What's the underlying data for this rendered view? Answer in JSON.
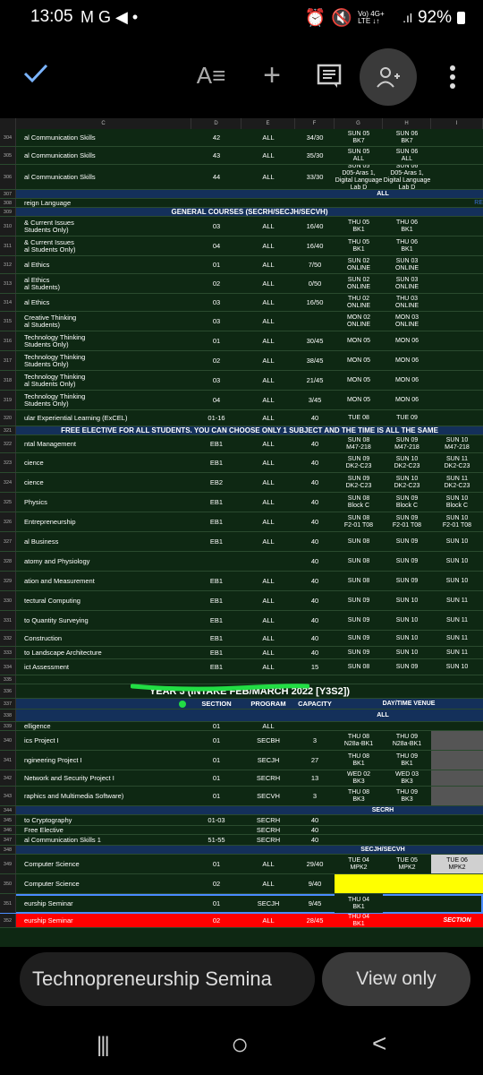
{
  "status_bar": {
    "time": "13:05",
    "notification_icons": "M G ◀ •",
    "network": "Vo) 4G+ LTE ↓↑",
    "battery": "92%"
  },
  "toolbar": {
    "icons": [
      "check-icon",
      "text-format-icon",
      "plus-icon",
      "comment-icon",
      "add-person-icon",
      "more-vert-icon"
    ]
  },
  "column_headers": [
    "C",
    "D",
    "E",
    "F",
    "G",
    "H",
    "I"
  ],
  "rows": [
    {
      "n": "304",
      "c": "al Communication Skills",
      "d": "42",
      "e": "ALL",
      "f": "34/30",
      "g": "SUN 05\nBK7",
      "h": "SUN 06\nBK7",
      "i": ""
    },
    {
      "n": "305",
      "c": "al Communication Skills",
      "d": "43",
      "e": "ALL",
      "f": "35/30",
      "g": "SUN 05\nALL",
      "h": "SUN 06\nALL",
      "i": ""
    },
    {
      "n": "306",
      "c": "al Communication Skills",
      "d": "44",
      "e": "ALL",
      "f": "33/30",
      "g": "SUN 05\nD05-Aras 1,\nDigital Language Lab D",
      "h": "SUN 06\nD05-Aras 1,\nDigital Language Lab D",
      "i": ""
    },
    {
      "n": "307",
      "c": "",
      "d": "",
      "e": "",
      "f": "",
      "g": "ALL",
      "h": "",
      "i": ""
    },
    {
      "n": "308",
      "c": "reign Language",
      "d": "",
      "e": "",
      "f": "",
      "g": "",
      "h": "",
      "i": "RE"
    },
    {
      "n": "309",
      "banner": "GENERAL COURSES (SECRH/SECJH/SECVH)"
    },
    {
      "n": "310",
      "c": "& Current Issues\nStudents Only)",
      "d": "03",
      "e": "ALL",
      "f": "16/40",
      "g": "THU 05\nBK1",
      "h": "THU 06\nBK1",
      "i": ""
    },
    {
      "n": "311",
      "c": "& Current Issues\nal Students Only)",
      "d": "04",
      "e": "ALL",
      "f": "16/40",
      "g": "THU 05\nBK1",
      "h": "THU 06\nBK1",
      "i": ""
    },
    {
      "n": "312",
      "c": "al Ethics",
      "d": "01",
      "e": "ALL",
      "f": "7/50",
      "g": "SUN 02\nONLINE",
      "h": "SUN 03\nONLINE",
      "i": ""
    },
    {
      "n": "313",
      "c": "al Ethics\nal Students)",
      "d": "02",
      "e": "ALL",
      "f": "0/50",
      "g": "SUN 02\nONLINE",
      "h": "SUN 03\nONLINE",
      "i": ""
    },
    {
      "n": "314",
      "c": "al Ethics",
      "d": "03",
      "e": "ALL",
      "f": "16/50",
      "g": "THU 02\nONLINE",
      "h": "THU 03\nONLINE",
      "i": ""
    },
    {
      "n": "315",
      "c": "Creative Thinking\nal Students)",
      "d": "03",
      "e": "ALL",
      "f": "",
      "g": "MON 02\nONLINE",
      "h": "MON 03\nONLINE",
      "i": ""
    },
    {
      "n": "316",
      "c": "Technology Thinking\nStudents Only)",
      "d": "01",
      "e": "ALL",
      "f": "30/45",
      "g": "MON 05",
      "h": "MON 06",
      "i": ""
    },
    {
      "n": "317",
      "c": "Technology Thinking\nStudents Only)",
      "d": "02",
      "e": "ALL",
      "f": "38/45",
      "g": "MON 05",
      "h": "MON 06",
      "i": ""
    },
    {
      "n": "318",
      "c": "Technology Thinking\nal Students Only)",
      "d": "03",
      "e": "ALL",
      "f": "21/45",
      "g": "MON 05",
      "h": "MON 06",
      "i": ""
    },
    {
      "n": "319",
      "c": "Technology Thinking\nStudents Only)",
      "d": "04",
      "e": "ALL",
      "f": "3/45",
      "g": "MON 05",
      "h": "MON 06",
      "i": ""
    },
    {
      "n": "320",
      "c": "ular Experiential Learning (ExCEL)",
      "d": "01-16",
      "e": "ALL",
      "f": "40",
      "g": "TUE 08",
      "h": "TUE 09",
      "i": ""
    },
    {
      "n": "321",
      "banner": "FREE ELECTIVE FOR ALL STUDENTS. YOU CAN CHOOSE ONLY 1 SUBJECT AND THE TIME IS ALL THE SAME"
    },
    {
      "n": "322",
      "c": "ntal Management",
      "d": "EB1",
      "e": "ALL",
      "f": "40",
      "g": "SUN 08\nM47-218",
      "h": "SUN 09\nM47-218",
      "i": "SUN 10\nM47-218"
    },
    {
      "n": "323",
      "c": "cience",
      "d": "EB1",
      "e": "ALL",
      "f": "40",
      "g": "SUN 09\nDK2-C23",
      "h": "SUN 10\nDK2-C23",
      "i": "SUN 11\nDK2-C23"
    },
    {
      "n": "324",
      "c": "cience",
      "d": "EB2",
      "e": "ALL",
      "f": "40",
      "g": "SUN 09\nDK2-C23",
      "h": "SUN 10\nDK2-C23",
      "i": "SUN 11\nDK2-C23"
    },
    {
      "n": "325",
      "c": "Physics",
      "d": "EB1",
      "e": "ALL",
      "f": "40",
      "g": "SUN 08\nBlock C",
      "h": "SUN 09\nBlock C",
      "i": "SUN 10\nBlock C"
    },
    {
      "n": "326",
      "c": "Entrepreneurship",
      "d": "EB1",
      "e": "ALL",
      "f": "40",
      "g": "SUN 08\nF2-01 T08",
      "h": "SUN 09\nF2-01 T08",
      "i": "SUN 10\nF2-01 T08"
    },
    {
      "n": "327",
      "c": "al Business",
      "d": "EB1",
      "e": "ALL",
      "f": "40",
      "g": "SUN 08",
      "h": "SUN 09",
      "i": "SUN 10"
    },
    {
      "n": "328",
      "c": "atomy and Physiology",
      "d": "",
      "e": "",
      "f": "40",
      "g": "SUN 08",
      "h": "SUN 09",
      "i": "SUN 10"
    },
    {
      "n": "329",
      "c": "ation and Measurement",
      "d": "EB1",
      "e": "ALL",
      "f": "40",
      "g": "SUN 08",
      "h": "SUN 09",
      "i": "SUN 10"
    },
    {
      "n": "330",
      "c": "tectural Computing",
      "d": "EB1",
      "e": "ALL",
      "f": "40",
      "g": "SUN 09",
      "h": "SUN 10",
      "i": "SUN 11"
    },
    {
      "n": "331",
      "c": "to Quantity Surveying",
      "d": "EB1",
      "e": "ALL",
      "f": "40",
      "g": "SUN 09",
      "h": "SUN 10",
      "i": "SUN 11"
    },
    {
      "n": "332",
      "c": "Construction",
      "d": "EB1",
      "e": "ALL",
      "f": "40",
      "g": "SUN 09",
      "h": "SUN 10",
      "i": "SUN 11"
    },
    {
      "n": "333",
      "c": "to Landscape Architecture",
      "d": "EB1",
      "e": "ALL",
      "f": "40",
      "g": "SUN 09",
      "h": "SUN 10",
      "i": "SUN 11"
    },
    {
      "n": "334",
      "c": "ict Assessment",
      "d": "EB1",
      "e": "ALL",
      "f": "15",
      "g": "SUN 08",
      "h": "SUN 09",
      "i": "SUN 10"
    },
    {
      "n": "335",
      "c": "",
      "d": "",
      "e": "",
      "f": "",
      "g": "",
      "h": "",
      "i": ""
    },
    {
      "n": "336",
      "banner": "YEAR 3 (INTAKE FEB/MARCH 2022 [Y3S2])"
    },
    {
      "n": "337",
      "c": "",
      "d": "SECTION",
      "e": "PROGRAM",
      "f": "CAPACITY",
      "g": "DAY/TIME VENUE",
      "h": "",
      "i": ""
    },
    {
      "n": "338",
      "c": "",
      "d": "",
      "e": "",
      "f": "",
      "g": "ALL",
      "h": "",
      "i": ""
    },
    {
      "n": "339",
      "c": "elligence",
      "d": "01",
      "e": "ALL",
      "f": "",
      "g": "",
      "h": "",
      "i": ""
    },
    {
      "n": "340",
      "c": "ics Project I",
      "d": "01",
      "e": "SECBH",
      "f": "3",
      "g": "THU 08\nN28a-BK1",
      "h": "THU 09\nN28a-BK1",
      "i": ""
    },
    {
      "n": "341",
      "c": "ngineering Project I",
      "d": "01",
      "e": "SECJH",
      "f": "27",
      "g": "THU 08\nBK1",
      "h": "THU 09\nBK1",
      "i": ""
    },
    {
      "n": "342",
      "c": "Network and Security Project I",
      "d": "01",
      "e": "SECRH",
      "f": "13",
      "g": "WED 02\nBK3",
      "h": "WED 03\nBK3",
      "i": ""
    },
    {
      "n": "343",
      "c": "raphics and Multimedia Software)",
      "d": "01",
      "e": "SECVH",
      "f": "3",
      "g": "THU 08\nBK3",
      "h": "THU 09\nBK3",
      "i": ""
    },
    {
      "n": "344",
      "c": "",
      "d": "",
      "e": "",
      "f": "",
      "g": "SECRH",
      "h": "",
      "i": ""
    },
    {
      "n": "345",
      "c": "to Cryptography",
      "d": "01-03",
      "e": "SECRH",
      "f": "40",
      "g": "",
      "h": "",
      "i": ""
    },
    {
      "n": "346",
      "c": "Free Elective",
      "d": "",
      "e": "SECRH",
      "f": "40",
      "g": "",
      "h": "",
      "i": ""
    },
    {
      "n": "347",
      "c": "al Communication Skills 1",
      "d": "51-55",
      "e": "SECRH",
      "f": "40",
      "g": "",
      "h": "",
      "i": ""
    },
    {
      "n": "348",
      "c": "",
      "d": "",
      "e": "",
      "f": "",
      "g": "SECJH/SECVH",
      "h": "",
      "i": ""
    },
    {
      "n": "349",
      "c": "Computer Science",
      "d": "01",
      "e": "ALL",
      "f": "29/40",
      "g": "TUE 04\nMPK2",
      "h": "TUE 05\nMPK2",
      "i": "TUE 06\nMPK2"
    },
    {
      "n": "350",
      "c": "Computer Science",
      "d": "02",
      "e": "ALL",
      "f": "9/40",
      "g": "",
      "h": "",
      "i": ""
    },
    {
      "n": "351",
      "c": "eurship Seminar",
      "d": "01",
      "e": "SECJH",
      "f": "9/45",
      "g": "THU 04\nBK1",
      "h": "",
      "i": ""
    },
    {
      "n": "352",
      "c": "eurship Seminar",
      "d": "02",
      "e": "ALL",
      "f": "28/45",
      "g": "THU 04\nBK1",
      "h": "",
      "i": "SECTION"
    }
  ],
  "bottom_bar": {
    "cell_preview": "Technopreneurship Semina",
    "mode_label": "View only"
  },
  "nav": {
    "recents": "|||",
    "home": "○",
    "back": "<"
  },
  "colors": {
    "sheet_bg": "#0e2813",
    "red_row": "#ff0000",
    "yellow_cell": "#ffff00",
    "blue_banner": "#1a2a6c"
  }
}
